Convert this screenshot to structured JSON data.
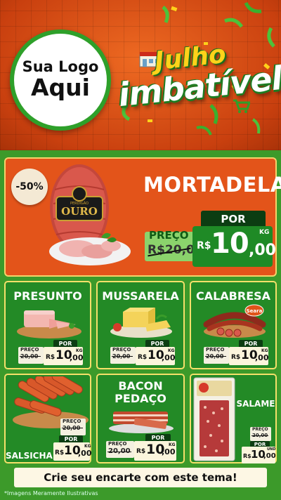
{
  "header": {
    "logo_line1": "Sua Logo",
    "logo_line2": "Aqui",
    "promo_word1": "Julho",
    "promo_word2": "imbatível"
  },
  "featured": {
    "discount": "-50%",
    "name": "MORTADELA",
    "old_label": "PREÇO",
    "old_value": "R$20,00",
    "new_label": "POR",
    "currency": "R$",
    "price_int": "10",
    "price_dec": ",00",
    "unit": "KG",
    "brand_small": "PERDIGÃO",
    "brand_big": "OURO"
  },
  "cards": [
    {
      "name": "PRESUNTO",
      "old_label": "PREÇO",
      "old_value": "20,00",
      "new_label": "POR",
      "currency": "R$",
      "price_int": "10",
      "price_dec": ",00",
      "unit": "KG"
    },
    {
      "name": "MUSSARELA",
      "old_label": "PREÇO",
      "old_value": "20,00",
      "new_label": "POR",
      "currency": "R$",
      "price_int": "10",
      "price_dec": ",00",
      "unit": "KG"
    },
    {
      "name": "CALABRESA",
      "brand": "Seara",
      "old_label": "PREÇO",
      "old_value": "20,00",
      "new_label": "POR",
      "currency": "R$",
      "price_int": "10",
      "price_dec": ",00",
      "unit": "KG"
    },
    {
      "name": "SALSICHA",
      "old_label": "PREÇO",
      "old_value": "20,00",
      "new_label": "POR",
      "currency": "R$",
      "price_int": "10",
      "price_dec": ",00",
      "unit": "KG"
    },
    {
      "name_line1": "BACON",
      "name_line2": "PEDAÇO",
      "old_label": "PREÇO",
      "old_value": "20,00",
      "new_label": "POR",
      "currency": "R$",
      "price_int": "10",
      "price_dec": ",00",
      "unit": "KG"
    },
    {
      "name": "SALAME",
      "old_label": "PREÇO",
      "old_value": "20,00",
      "new_label": "POR",
      "currency": "R$",
      "price_int": "10",
      "price_dec": ",00",
      "unit": "UND"
    }
  ],
  "footer": {
    "cta": "Crie seu encarte com este tema!",
    "disclaimer": "*Imagens Meramente Ilustrativas"
  },
  "colors": {
    "header_orange": "#e05a1c",
    "green": "#238a26",
    "dark_green": "#0c3d12",
    "yellow": "#ffd21a",
    "cream": "#fbf5dc"
  }
}
